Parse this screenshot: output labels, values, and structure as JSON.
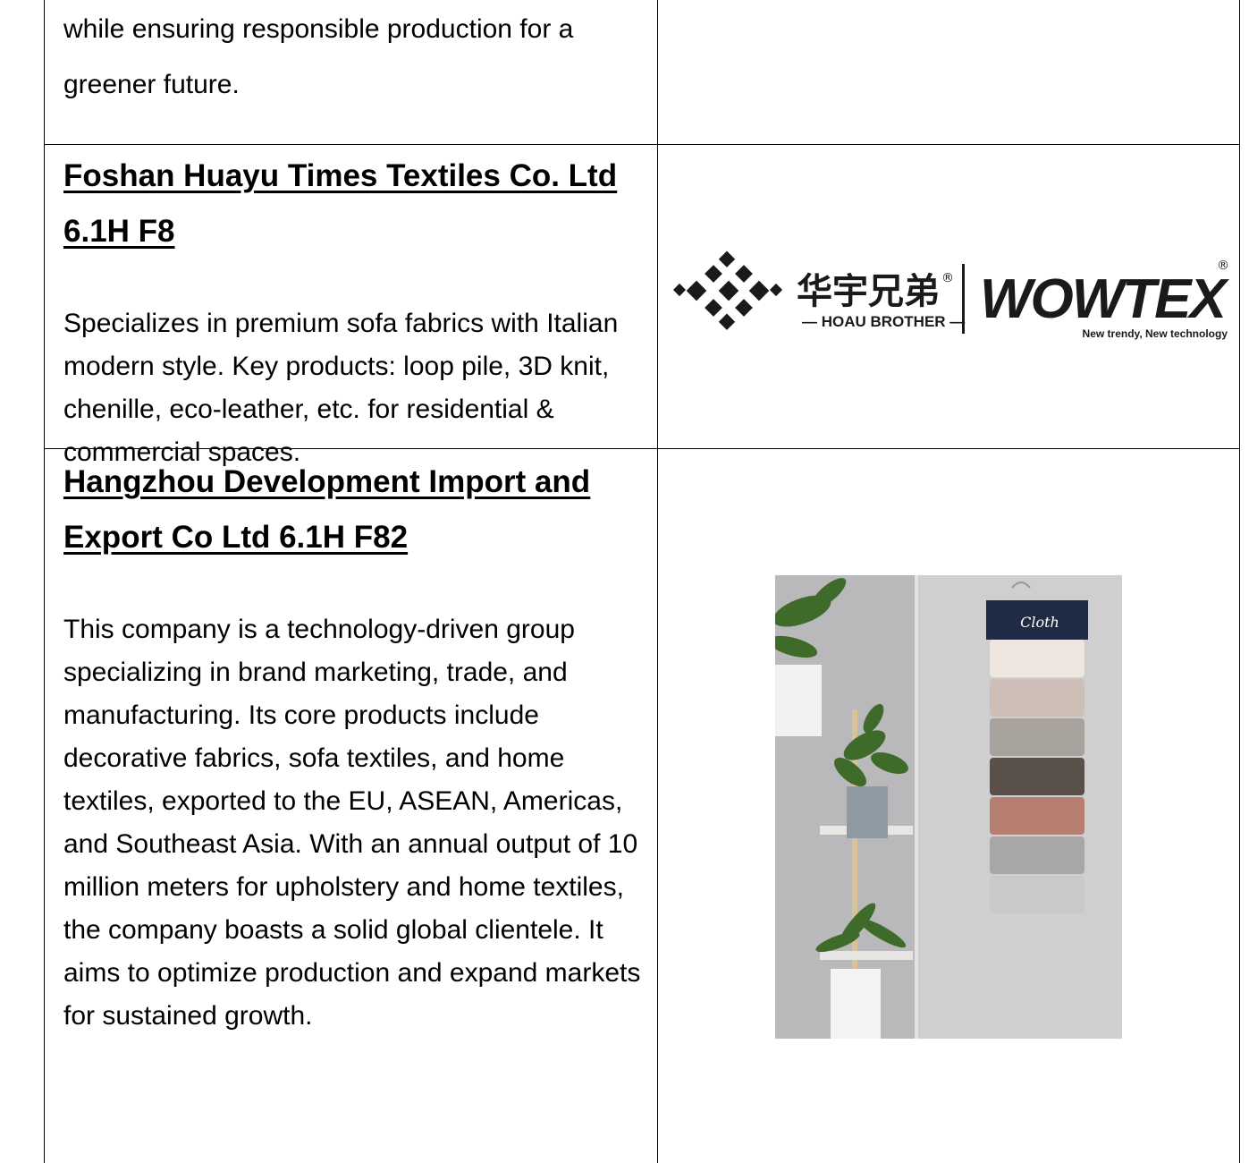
{
  "intro": {
    "continued_text": "while ensuring responsible production for a greener future."
  },
  "companies": [
    {
      "name": "Foshan Huayu Times Textiles Co. Ltd 6.1H F8",
      "description": "Specializes in premium sofa fabrics with Italian modern style. Key products: loop pile, 3D knit, chenille, eco-leather, etc. for residential & commercial spaces.",
      "logo": {
        "icon": "woven-diamond-logo-icon",
        "chinese_brand": "华宇兄弟",
        "brand_en": "— HOAU BROTHER —",
        "brand_second": "WOWTEX",
        "registered": "®",
        "tagline": "New trendy, New technology",
        "color": "#1a1a1a"
      }
    },
    {
      "name": "Hangzhou Development Import and Export Co Ltd 6.1H F82",
      "description": "This company is a technology-driven group specializing in brand marketing, trade, and manufacturing. Its core products include decorative fabrics, sofa textiles, and home textiles, exported to the EU, ASEAN, Americas, and Southeast Asia. With an annual output of 10 million meters for upholstery and home textiles, the company boasts a solid global clientele. It aims to optimize production and expand markets for sustained growth.",
      "photo": {
        "hanger_label": "Cloth",
        "swatch_colors": [
          "#efe6df",
          "#cdbfb5",
          "#a9a39e",
          "#5a504a",
          "#b77f72",
          "#a7a7a7",
          "#c9c9c9"
        ],
        "wall_color": "#cfcfd1"
      }
    }
  ]
}
